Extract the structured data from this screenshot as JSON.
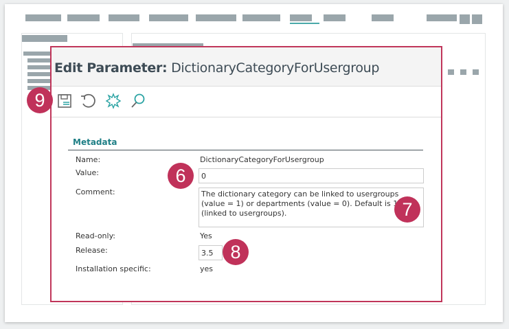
{
  "modal": {
    "title_bold": "Edit Parameter:",
    "title_name": "DictionaryCategoryForUsergroup",
    "toolbar": [
      "save-icon",
      "undo-icon",
      "new-icon",
      "search-icon"
    ],
    "section": "Metadata",
    "fields": {
      "name_label": "Name:",
      "name_value": "DictionaryCategoryForUsergroup",
      "value_label": "Value:",
      "value_value": "0",
      "comment_label": "Comment:",
      "comment_value": "The dictionary category can be linked to usergroups (value = 1) or departments (value = 0). Default is 1 (linked to usergroups).",
      "readonly_label": "Read-only:",
      "readonly_value": "Yes",
      "release_label": "Release:",
      "release_value": "3.5",
      "install_label": "Installation specific:",
      "install_value": "yes"
    }
  },
  "badges": {
    "b9": "9",
    "b6": "6",
    "b7": "7",
    "b8": "8"
  },
  "colors": {
    "accent": "#c0355a",
    "teal": "#1f7f86"
  }
}
